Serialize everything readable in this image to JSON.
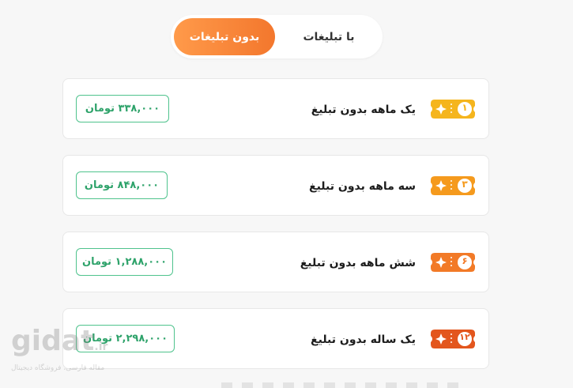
{
  "tabs": {
    "active_label": "بدون تبلیغات",
    "inactive_label": "با تبلیغات"
  },
  "plans": [
    {
      "badge": "۱",
      "name": "یک ماهه بدون تبلیغ",
      "price": "۳۳۸,۰۰۰ تومان",
      "badge_color": "#f5b51d"
    },
    {
      "badge": "۳",
      "name": "سه ماهه بدون تبلیغ",
      "price": "۸۴۸,۰۰۰ تومان",
      "badge_color": "#f59a1d"
    },
    {
      "badge": "۶",
      "name": "شش ماهه بدون تبلیغ",
      "price": "۱,۲۸۸,۰۰۰ تومان",
      "badge_color": "#f27a27"
    },
    {
      "badge": "۱۲",
      "name": "یک ساله بدون تبلیغ",
      "price": "۲,۲۹۸,۰۰۰ تومان",
      "badge_color": "#e3561d"
    }
  ],
  "watermark": {
    "logo": "gidat",
    "tld": ".ir",
    "tagline": "مقاله فارسی، فروشگاه دیجیتال"
  },
  "colors": {
    "accent": "#f3772d",
    "price_green": "#2fa36b",
    "price_border": "#4fc38d"
  }
}
